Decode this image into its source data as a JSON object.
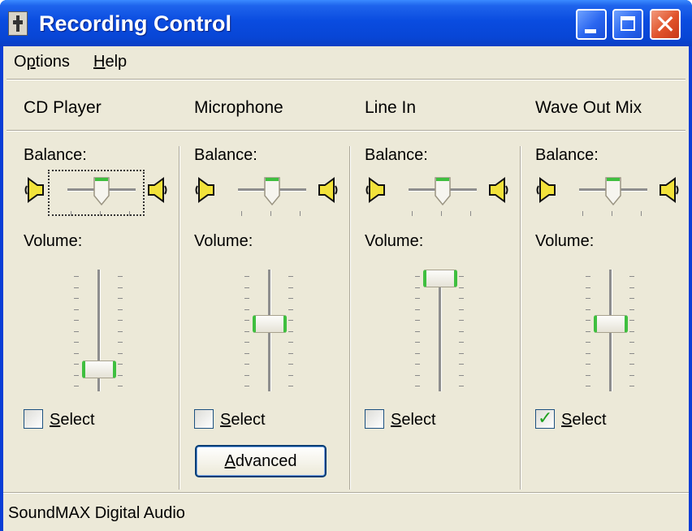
{
  "window": {
    "title": "Recording Control"
  },
  "titlebar_buttons": {
    "minimize": "minimize-icon",
    "maximize": "maximize-icon",
    "close": "close-icon"
  },
  "menu": {
    "options_mnemonic": "p",
    "options_before": "O",
    "options_after": "tions",
    "help_mnemonic": "H",
    "help_after": "elp"
  },
  "channels": [
    {
      "name": "CD Player",
      "balance_label": "Balance:",
      "volume_label": "Volume:",
      "select_label": "elect",
      "select_mnemonic": "S",
      "selected": false,
      "volume_level": 0.15,
      "balance_level": 0.0
    },
    {
      "name": "Microphone",
      "balance_label": "Balance:",
      "volume_label": "Volume:",
      "select_label": "elect",
      "select_mnemonic": "S",
      "selected": false,
      "volume_level": 0.55,
      "balance_level": 0.0
    },
    {
      "name": "Line In",
      "balance_label": "Balance:",
      "volume_label": "Volume:",
      "select_label": "elect",
      "select_mnemonic": "S",
      "selected": false,
      "volume_level": 0.95,
      "balance_level": 0.0
    },
    {
      "name": "Wave Out Mix",
      "balance_label": "Balance:",
      "volume_label": "Volume:",
      "select_label": "elect",
      "select_mnemonic": "S",
      "selected": true,
      "volume_level": 0.55,
      "balance_level": 0.0
    }
  ],
  "advanced_button": {
    "mnemonic": "A",
    "label_rest": "dvanced"
  },
  "status_bar": {
    "text": "SoundMAX Digital Audio"
  },
  "colors": {
    "titlebar": "#0a4ce0",
    "face": "#ece9d8",
    "thumb_accent": "#3fbf3f",
    "check": "#21a121"
  }
}
